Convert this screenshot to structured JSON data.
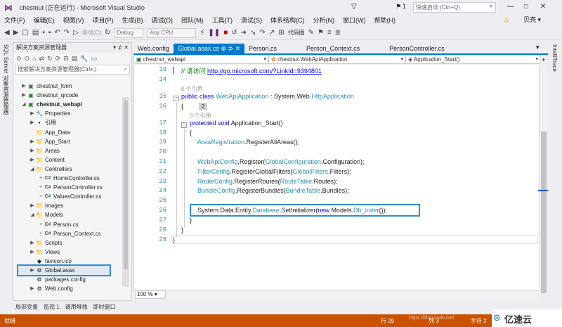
{
  "titlebar": {
    "logo": "⋈",
    "title": "chestnut (正在运行) - Microsoft Visual Studio",
    "flag_count": "1",
    "quick_launch_placeholder": "快速启动 (Ctrl+Q)",
    "minimize": "—",
    "maximize": "□",
    "close": "✕"
  },
  "menu": {
    "items": [
      "文件(F)",
      "编辑(E)",
      "视图(V)",
      "项目(P)",
      "生成(B)",
      "调试(D)",
      "团队(M)",
      "工具(T)",
      "测试(S)",
      "体系结构(C)",
      "分析(N)",
      "窗口(W)",
      "帮助(H)"
    ],
    "user": "贝壳 ▾"
  },
  "toolbar": {
    "continue_label": "继续(C)",
    "config_value": "Debug",
    "platform_value": "Any CPU",
    "codemap_label": "代码图"
  },
  "left_strip_label": "SQL Server 对象资源管理器",
  "solution_explorer": {
    "title": "解决方案资源管理器",
    "pin_controls": "▾ ⊅ ✕",
    "search_placeholder": "搜索解决方案资源管理器(Ctrl+;)",
    "tree": [
      {
        "label": "chestnut_form",
        "icon": "▣",
        "arrow": "▶",
        "bold": false
      },
      {
        "label": "chestnut_qrcode",
        "icon": "▣",
        "arrow": "▶",
        "bold": false
      },
      {
        "label": "chestnut_webapi",
        "icon": "▣",
        "arrow": "◢",
        "bold": true
      },
      {
        "label": "Properties",
        "icon": "🔧",
        "arrow": "▶",
        "bold": false
      },
      {
        "label": "引用",
        "icon": "▪",
        "arrow": "▶",
        "bold": false
      },
      {
        "label": "App_Data",
        "icon": "📁",
        "arrow": "",
        "bold": false
      },
      {
        "label": "App_Start",
        "icon": "📁",
        "arrow": "▶",
        "bold": false
      },
      {
        "label": "Areas",
        "icon": "📁",
        "arrow": "▶",
        "bold": false
      },
      {
        "label": "Content",
        "icon": "📁",
        "arrow": "▶",
        "bold": false
      },
      {
        "label": "Controllers",
        "icon": "📁",
        "arrow": "◢",
        "bold": false
      },
      {
        "label": "HomeController.cs",
        "icon": "C#",
        "arrow": "+",
        "bold": false
      },
      {
        "label": "PersonController.cs",
        "icon": "C#",
        "arrow": "+",
        "bold": false
      },
      {
        "label": "ValuesController.cs",
        "icon": "C#",
        "arrow": "+",
        "bold": false
      },
      {
        "label": "Images",
        "icon": "📁",
        "arrow": "▶",
        "bold": false
      },
      {
        "label": "Models",
        "icon": "📁",
        "arrow": "◢",
        "bold": false
      },
      {
        "label": "Person.cs",
        "icon": "C#",
        "arrow": "+",
        "bold": false
      },
      {
        "label": "Person_Context.cs",
        "icon": "C#",
        "arrow": "+",
        "bold": false
      },
      {
        "label": "Scripts",
        "icon": "📁",
        "arrow": "▶",
        "bold": false
      },
      {
        "label": "Views",
        "icon": "📁",
        "arrow": "▶",
        "bold": false
      },
      {
        "label": "favicon.ico",
        "icon": "◆",
        "arrow": "",
        "bold": false
      },
      {
        "label": "Global.asax",
        "icon": "⚙",
        "arrow": "▶",
        "bold": false
      },
      {
        "label": "packages.config",
        "icon": "⚙",
        "arrow": "",
        "bold": false
      },
      {
        "label": "Web.config",
        "icon": "⚙",
        "arrow": "▶",
        "bold": false
      }
    ]
  },
  "editor_tabs": [
    {
      "label": "Web.config",
      "active": false
    },
    {
      "label": "Global.asax.cs ⊕ ⊅ ✕",
      "active": true
    },
    {
      "label": "Person.cs",
      "active": false
    },
    {
      "label": "Person_Context.cs",
      "active": false
    },
    {
      "label": "PersonController.cs",
      "active": false
    }
  ],
  "nav_bar": {
    "project": "chestnut_webapi",
    "class": "chestnut.WebApiApplication",
    "member": "Application_Start()"
  },
  "code": {
    "line_numbers": [
      "13",
      "14",
      "15",
      "16",
      "17",
      "18",
      "19",
      "20",
      "21",
      "22",
      "23",
      "24",
      "25",
      "26",
      "27",
      "28",
      "29"
    ],
    "comment_prefix": "// 请访问 ",
    "comment_link": "http://go.microsoft.com/?LinkId=9394801",
    "ref_count_1": "0 个引用",
    "ref_count_2": "0 个引用",
    "codelens_badge": "2",
    "kw_public": "public",
    "kw_class": "class",
    "class_name": "WebApiApplication",
    "colon_sep": " : System.Web.",
    "base_class": "HttpApplication",
    "brace_open": "{",
    "brace_close": "}",
    "kw_protected": "protected",
    "kw_void": "void",
    "method_name": "Application_Start()",
    "l19_type": "AreaRegistration",
    "l19_rest": ".RegisterAllAreas();",
    "l21_type": "WebApiConfig",
    "l21_mid": ".Register(",
    "l21_type2": "GlobalConfiguration",
    "l21_rest": ".Configuration);",
    "l22_type": "FilterConfig",
    "l22_mid": ".RegisterGlobalFilters(",
    "l22_type2": "GlobalFilters",
    "l22_rest": ".Filters);",
    "l23_type": "RouteConfig",
    "l23_mid": ".RegisterRoutes(",
    "l23_type2": "RouteTable",
    "l23_rest": ".Routes);",
    "l24_type": "BundleConfig",
    "l24_mid": ".RegisterBundles(",
    "l24_type2": "BundleTable",
    "l24_rest": ".Bundles);",
    "l26_prefix": "System.Data.Entity.",
    "l26_type": "Database",
    "l26_mid": ".SetInitializer(",
    "l26_kw": "new",
    "l26_mid2": " Models.",
    "l26_type2": "Db_Initer",
    "l26_rest": "());"
  },
  "zoom": "100 %",
  "right_strip_label": "IntelliTrace",
  "bottom_tabs": [
    "局部变量",
    "监视 1",
    "调用堆栈",
    "即时窗口"
  ],
  "status": {
    "ready": "就绪",
    "row": "行 29",
    "col": "列 3",
    "char": "字符 2",
    "watermark": "https://blog.csdn.net/",
    "brand": "亿速云",
    "brand_icon": "⊛"
  }
}
